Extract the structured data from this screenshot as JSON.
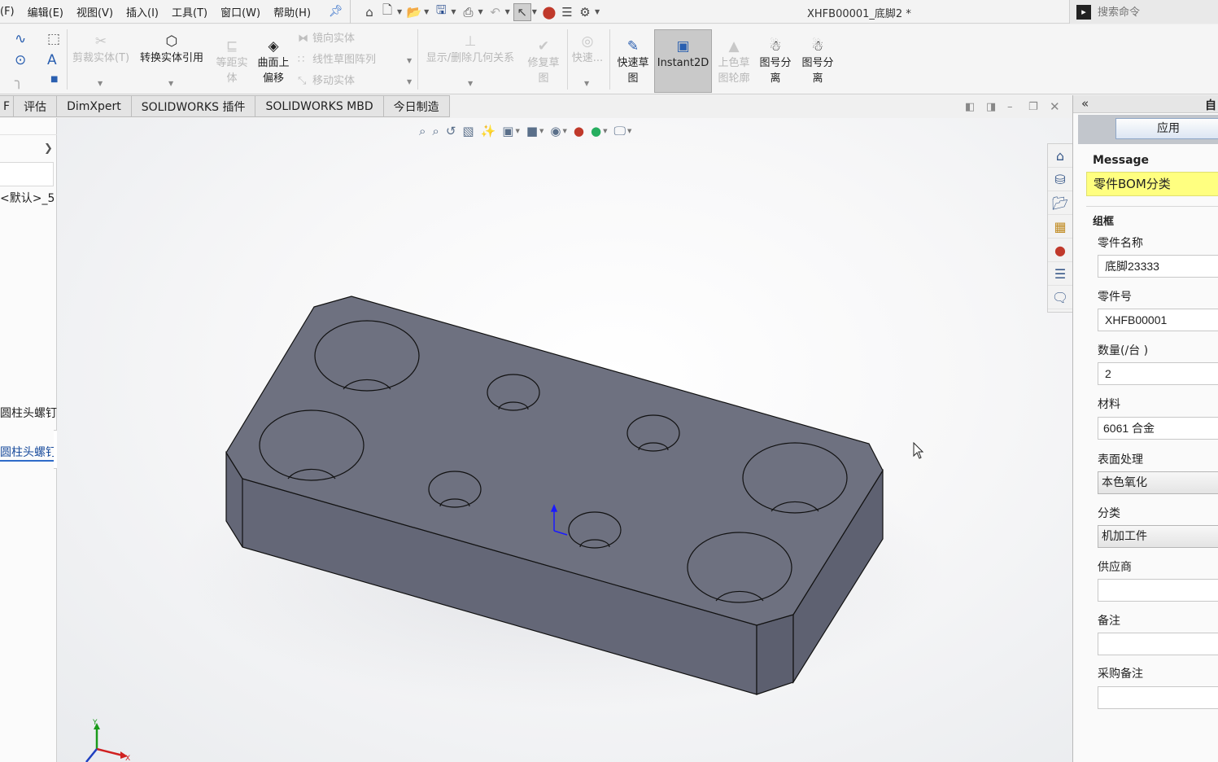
{
  "menubar": {
    "items": [
      "(F)",
      "编辑(E)",
      "视图(V)",
      "插入(I)",
      "工具(T)",
      "窗口(W)",
      "帮助(H)"
    ],
    "doc_title": "XHFB00001_底脚2 *",
    "search_placeholder": "搜索命令"
  },
  "ribbon": {
    "trim_entities": "剪裁实体(T)",
    "convert_entities": "转换实体引用",
    "offset_entities_1": "等距实",
    "offset_entities_2": "体",
    "offset_on_surface_1": "曲面上",
    "offset_on_surface_2": "偏移",
    "mirror_entities": "镜向实体",
    "linear_pattern": "线性草图阵列",
    "move_entities": "移动实体",
    "display_relations": "显示/删除几何关系",
    "repair_sketch_1": "修复草",
    "repair_sketch_2": "图",
    "quick_snaps": "快速...",
    "rapid_sketch_1": "快速草",
    "rapid_sketch_2": "图",
    "instant2d": "Instant2D",
    "shaded_sketch_1": "上色草",
    "shaded_sketch_2": "图轮廓",
    "split_drawing_a_1": "图号分",
    "split_drawing_a_2": "离",
    "split_drawing_b_1": "图号分",
    "split_drawing_b_2": "离"
  },
  "tabs": [
    "F",
    "评估",
    "DimXpert",
    "SOLIDWORKS 插件",
    "SOLIDWORKS MBD",
    "今日制造"
  ],
  "tree": {
    "default_config": "<默认>_5",
    "item_1": "圆柱头螺钉",
    "item_2": "圆柱头螺钉"
  },
  "panel": {
    "title": "自定",
    "apply": "应用",
    "message_title": "Message",
    "message": "零件BOM分类",
    "group": "组框",
    "fields": [
      {
        "label": "零件名称",
        "value": "底脚23333"
      },
      {
        "label": "零件号",
        "value": "XHFB00001"
      },
      {
        "label": "数量(/台 )",
        "value": "2"
      },
      {
        "label": "材料",
        "value": "6061 合金"
      },
      {
        "label": "表面处理",
        "value": "本色氧化"
      },
      {
        "label": "分类",
        "value": "机加工件"
      },
      {
        "label": "供应商",
        "value": ""
      },
      {
        "label": "备注",
        "value": ""
      },
      {
        "label": "采购备注",
        "value": ""
      }
    ]
  },
  "triad": {
    "x": "X",
    "y": "Y"
  },
  "colors": {
    "model_face": "#6e7180",
    "model_side": "#5f6272",
    "message_bg": "#ffff80",
    "accent": "#2e6bc9"
  },
  "icons": [
    "home-icon",
    "new-document-icon",
    "open-folder-icon",
    "save-icon",
    "print-icon",
    "undo-icon",
    "select-arrow-icon",
    "traffic-light-icon",
    "options-icon",
    "gear-icon",
    "search-command-icon"
  ]
}
